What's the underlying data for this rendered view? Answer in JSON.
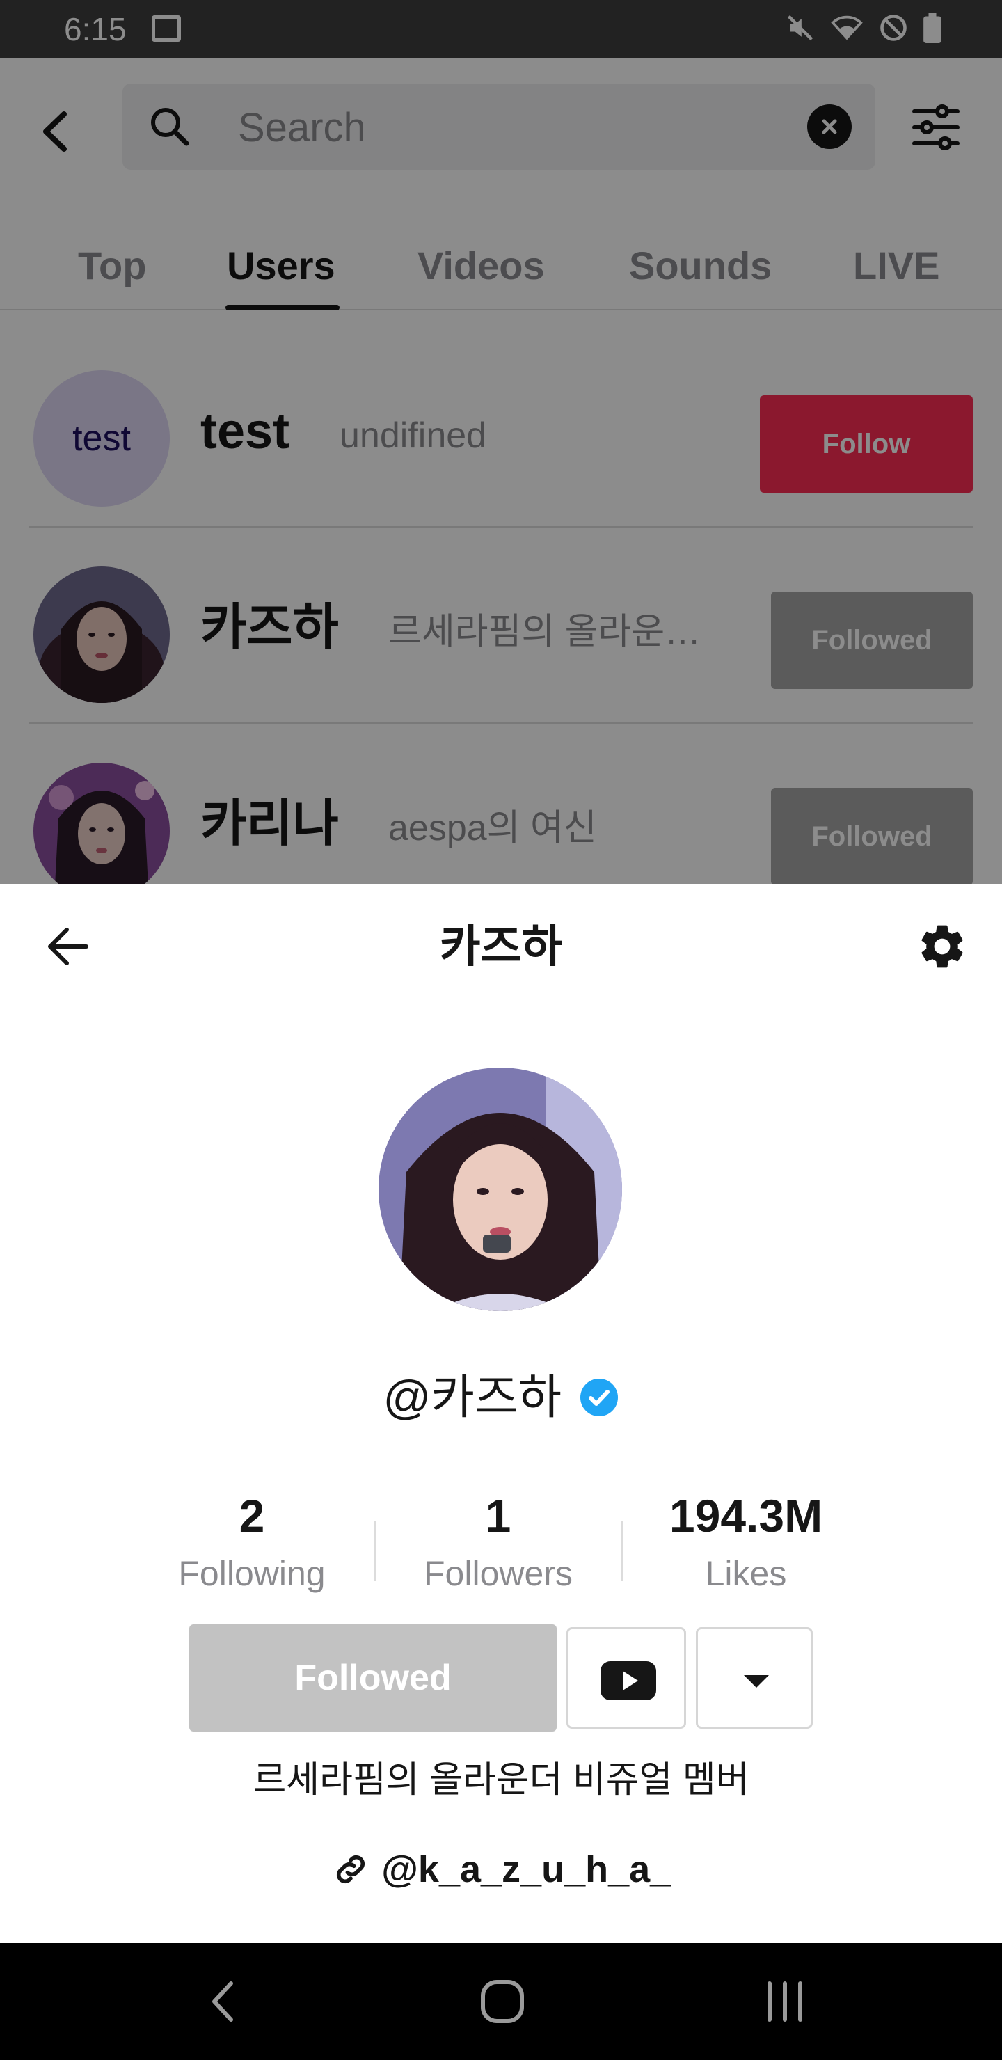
{
  "status_bar": {
    "time": "6:15",
    "icons": [
      "image-icon",
      "mute-icon",
      "wifi-icon",
      "dnd-icon",
      "battery-icon"
    ]
  },
  "search": {
    "placeholder": "Search",
    "icons": [
      "back-chevron-icon",
      "search-icon",
      "clear-icon",
      "filter-sliders-icon"
    ]
  },
  "tabs": [
    {
      "label": "Top"
    },
    {
      "label": "Users",
      "active": true
    },
    {
      "label": "Videos"
    },
    {
      "label": "Sounds"
    },
    {
      "label": "LIVE"
    }
  ],
  "results": [
    {
      "avatar_text": "test",
      "name": "test",
      "desc": "undifined",
      "button": "Follow"
    },
    {
      "name": "카즈하",
      "desc": "르세라핌의 올라운…",
      "button": "Followed"
    },
    {
      "name": "카리나",
      "desc": "aespa의 여신",
      "button": "Followed"
    }
  ],
  "profile": {
    "title": "카즈하",
    "handle": "@카즈하",
    "stats": [
      {
        "value": "2",
        "label": "Following"
      },
      {
        "value": "1",
        "label": "Followers"
      },
      {
        "value": "194.3M",
        "label": "Likes"
      }
    ],
    "followed_label": "Followed",
    "bio": "르세라핌의 올라운더 비쥬얼 멤버",
    "link": "@k_a_z_u_h_a_"
  },
  "colors": {
    "accent": "#fe2c55",
    "followed_gray": "#a6a6a6",
    "verified_blue": "#20a5f5",
    "status_bar": "#3f3f3f"
  }
}
